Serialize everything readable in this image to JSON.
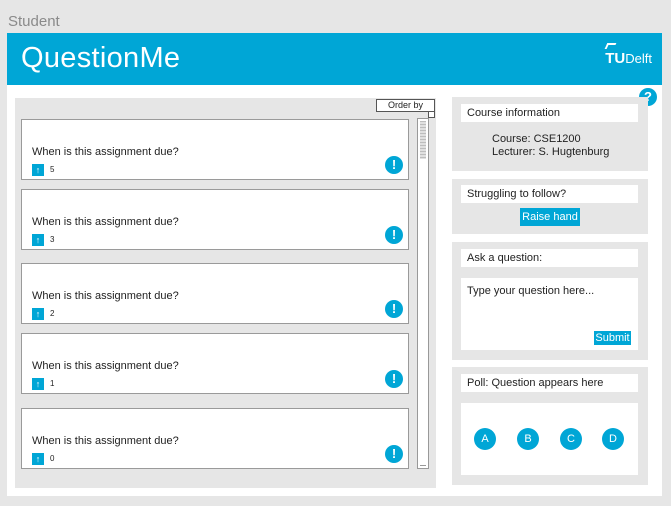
{
  "role_label": "Student",
  "header": {
    "title": "QuestionMe",
    "logo_tu": "TU",
    "logo_delft": "Delft"
  },
  "help_icon": "?",
  "questions": {
    "order_by_label": "Order by",
    "items": [
      {
        "text": "When is this assignment due?",
        "votes": "5"
      },
      {
        "text": "When is this assignment due?",
        "votes": "3"
      },
      {
        "text": "When is this assignment due?",
        "votes": "2"
      },
      {
        "text": "When is this assignment due?",
        "votes": "1"
      },
      {
        "text": "When is this assignment due?",
        "votes": "0"
      }
    ],
    "upvote_glyph": "↑",
    "flag_glyph": "!"
  },
  "course": {
    "header": "Course information",
    "course_line": "Course: CSE1200",
    "lecturer_line": "Lecturer: S. Hugtenburg"
  },
  "struggling": {
    "header": "Struggling to follow?",
    "button": "Raise hand"
  },
  "ask": {
    "header": "Ask a question:",
    "placeholder": "Type your question here...",
    "submit": "Submit"
  },
  "poll": {
    "header": "Poll: Question appears here",
    "options": [
      "A",
      "B",
      "C",
      "D"
    ]
  },
  "colors": {
    "accent": "#00a6d6",
    "panel": "#e6e6e6"
  }
}
